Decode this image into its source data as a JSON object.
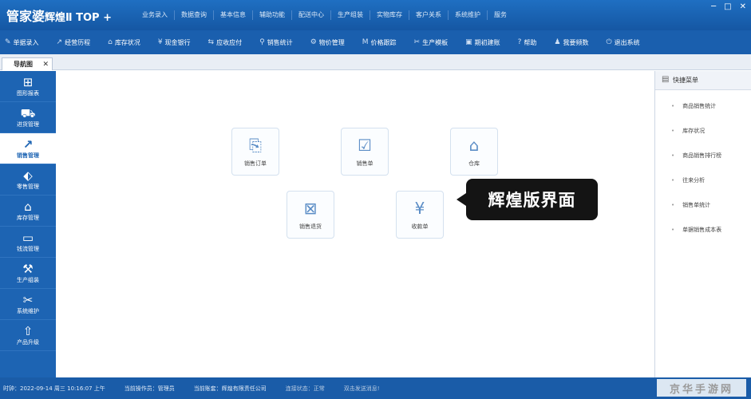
{
  "app": {
    "logo_main": "管家婆",
    "logo_sub": "辉煌Ⅱ TOP +"
  },
  "top_menu": [
    "业务录入",
    "数据查询",
    "基本信息",
    "辅助功能",
    "配送中心",
    "生产组装",
    "实物库存",
    "客户关系",
    "系统维护",
    "服务"
  ],
  "window_controls": [
    "─",
    "□",
    "✕"
  ],
  "toolbar": [
    {
      "icon": "document-icon",
      "glyph": "✎",
      "label": "单据录入"
    },
    {
      "icon": "chart-icon",
      "glyph": "↗",
      "label": "经营历程"
    },
    {
      "icon": "warehouse-icon",
      "glyph": "⌂",
      "label": "库存状况"
    },
    {
      "icon": "yen-icon",
      "glyph": "¥",
      "label": "现金银行"
    },
    {
      "icon": "transfer-icon",
      "glyph": "⇆",
      "label": "应收应付"
    },
    {
      "icon": "search-icon",
      "glyph": "⚲",
      "label": "销售统计"
    },
    {
      "icon": "gear-icon",
      "glyph": "⚙",
      "label": "物价管理"
    },
    {
      "icon": "trend-icon",
      "glyph": "M",
      "label": "价格跟踪"
    },
    {
      "icon": "tools-icon",
      "glyph": "✂",
      "label": "生产模板"
    },
    {
      "icon": "edit-icon",
      "glyph": "▣",
      "label": "期初建账"
    },
    {
      "icon": "help-icon",
      "glyph": "?",
      "label": "帮助"
    },
    {
      "icon": "users-icon",
      "glyph": "♟",
      "label": "我要频数"
    },
    {
      "icon": "power-icon",
      "glyph": "⏻",
      "label": "退出系统"
    }
  ],
  "tab": {
    "label": "导航图",
    "close": "✕"
  },
  "sidebar": [
    {
      "icon": "grid-icon",
      "glyph": "⊞",
      "label": "图形报表",
      "active": false
    },
    {
      "icon": "cart-icon",
      "glyph": "⛟",
      "label": "进货管理",
      "active": false
    },
    {
      "icon": "line-chart-icon",
      "glyph": "↗",
      "label": "销售管理",
      "active": true
    },
    {
      "icon": "tag-icon",
      "glyph": "⬖",
      "label": "零售管理",
      "active": false
    },
    {
      "icon": "home-icon",
      "glyph": "⌂",
      "label": "库存管理",
      "active": false
    },
    {
      "icon": "money-icon",
      "glyph": "▭",
      "label": "钱流管理",
      "active": false
    },
    {
      "icon": "wrench-icon",
      "glyph": "⚒",
      "label": "生产组装",
      "active": false
    },
    {
      "icon": "tools-icon",
      "glyph": "✂",
      "label": "系统维护",
      "active": false
    },
    {
      "icon": "upload-icon",
      "glyph": "⇧",
      "label": "产品升级",
      "active": false
    }
  ],
  "cards": [
    {
      "name": "sales-order",
      "icon": "clipboard-box-icon",
      "glyph": "⎘",
      "label": "销售订单"
    },
    {
      "name": "sales-slip",
      "icon": "clipboard-check-icon",
      "glyph": "☑",
      "label": "销售单"
    },
    {
      "name": "warehouse",
      "icon": "house-icon",
      "glyph": "⌂",
      "label": "仓库"
    },
    {
      "name": "sales-return",
      "icon": "return-icon",
      "glyph": "⊠",
      "label": "销售退货"
    },
    {
      "name": "receipt",
      "icon": "money-bag-icon",
      "glyph": "¥",
      "label": "收款单"
    }
  ],
  "callout": "辉煌版界面",
  "right_panel": {
    "title": "快捷菜单",
    "items": [
      "商品销售统计",
      "库存状况",
      "商品销售排行榜",
      "往来分析",
      "销售单统计",
      "单据销售成本表"
    ]
  },
  "status": {
    "time": "时钟：2022-09-14 周三 10:16:07 上午",
    "operator": "当前操作员：管理员",
    "account": "当前账套：辉煌有限责任公司",
    "connection": "连接状态：正常",
    "message": "双击发送消息!"
  },
  "watermark": "京华手游网"
}
